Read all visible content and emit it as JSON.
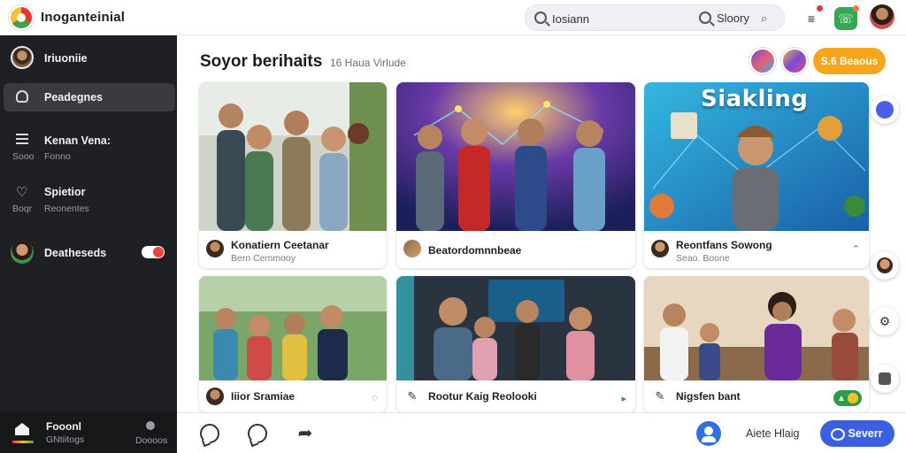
{
  "app": {
    "name": "Inoganteinial"
  },
  "search": {
    "value": "Iosiann",
    "secondary_label": "Sloory"
  },
  "sidebar": {
    "profile_label": "Iriuoniie",
    "items": [
      {
        "label": "Peadegnes"
      },
      {
        "label": "Kenan Vena:",
        "sub_left": "Sooo",
        "sub_right": "Fonno"
      },
      {
        "label": "Spietior",
        "sub_left": "Boqr",
        "sub_right": "Reonentes"
      },
      {
        "label": "Deatheseds"
      }
    ],
    "footer": {
      "title": "Fooonl",
      "sub": "GNtiitogs",
      "right": "Doooos"
    }
  },
  "main": {
    "title": "Soyor berihaits",
    "subtitle": "16 Haua Virlude",
    "join_label": "S.6 Beaous"
  },
  "cards": [
    {
      "title": "Konatiern Ceetanar",
      "sub": "Bern Cemmooy"
    },
    {
      "title": "Beatordomnnbeae"
    },
    {
      "title": "Reontfans Sowong",
      "sub": "Seao. Boone",
      "thumb_title": "Siakling"
    },
    {
      "title": "Iiior Sramiae"
    },
    {
      "title": "Rootur Kaig Reolooki"
    },
    {
      "title": "Nigsfen bant"
    }
  ],
  "bottom": {
    "label": "Aiete Hlaig",
    "send_label": "Severr"
  },
  "colors": {
    "accent": "#3b5fe0",
    "join": "#f6a61a",
    "sidebar": "#1f2023",
    "live": "#2e9b47"
  }
}
